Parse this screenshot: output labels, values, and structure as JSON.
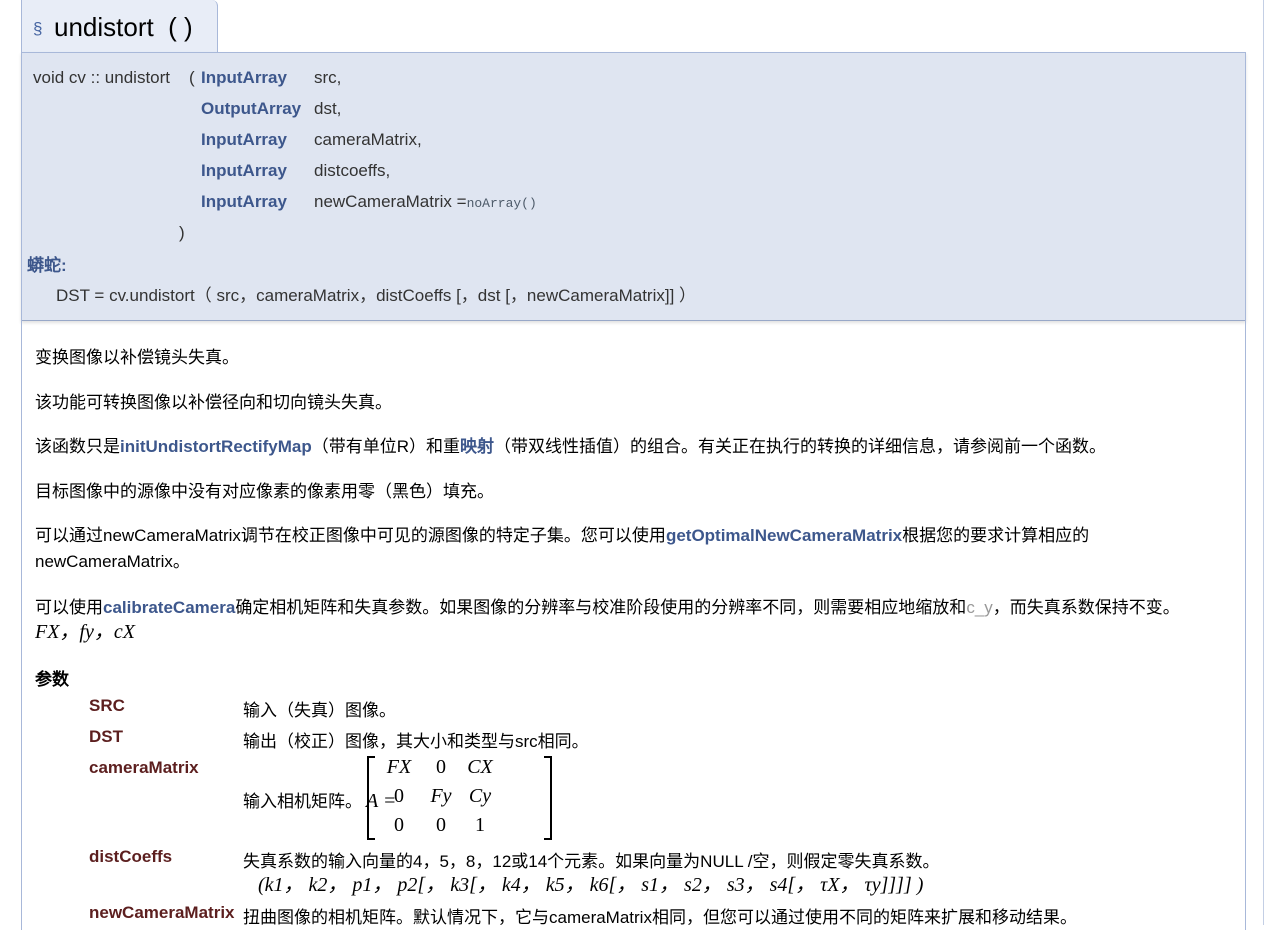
{
  "heading": {
    "section_mark": "§",
    "title": "undistort  ( )"
  },
  "signature": {
    "prefix": "void cv :: undistort",
    "open_paren": "(",
    "params": [
      {
        "type": "InputArray",
        "name": "src,"
      },
      {
        "type": "OutputArray",
        "name": "dst,"
      },
      {
        "type": "InputArray",
        "name": "cameraMatrix,"
      },
      {
        "type": "InputArray",
        "name": "distcoeffs,"
      },
      {
        "type": "InputArray",
        "name": "newCameraMatrix =",
        "default": "noArray()"
      }
    ],
    "close_paren": ")"
  },
  "python": {
    "label": "蟒蛇:",
    "code": "DST = cv.undistort（ src，cameraMatrix，distCoeffs [，dst [，newCameraMatrix]] ）"
  },
  "description": {
    "p1": "变换图像以补偿镜头失真。",
    "p2": "该功能可转换图像以补偿径向和切向镜头失真。",
    "p3": {
      "a": "该函数只是",
      "link1": "initUndistortRectifyMap",
      "b": "（带有单位R）和重",
      "link2": "映射",
      "c": "（带双线性插值）的组合。有关正在执行的转换的详细信息，请参阅前一个函数。"
    },
    "p4": "目标图像中的源像中没有对应像素的像素用零（黑色）填充。",
    "p5": {
      "a": "可以通过newCameraMatrix调节在校正图像中可见的源图像的特定子集。您可以使用",
      "link": "getOptimalNewCameraMatrix",
      "b": "根据您的要求计算相应的",
      "c": "newCameraMatrix。"
    },
    "p6": {
      "a": "可以使用",
      "link": "calibrateCamera",
      "b": "确定相机矩阵和失真参数。如果图像的分辨率与校准阶段使用的分辨率不同，则需要相应地缩放和",
      "grey": "c_y",
      "c": "，而失真系数保持不变。",
      "math": "F",
      "math_line": "FX，fy，cX"
    }
  },
  "parameters": {
    "heading": "参数",
    "items": [
      {
        "name": "SRC",
        "desc": "输入（失真）图像。"
      },
      {
        "name": "DST",
        "desc": "输出（校正）图像，其大小和类型与src相同。"
      },
      {
        "name": "cameraMatrix",
        "desc": "输入相机矩阵。"
      },
      {
        "name": "distCoeffs",
        "desc": "失真系数的输入向量的4，5，8，12或14个元素。如果向量为NULL /空，则假定零失真系数。"
      },
      {
        "name": "newCameraMatrix",
        "desc": "扭曲图像的相机矩阵。默认情况下，它与cameraMatrix相同，但您可以通过使用不同的矩阵来扩展和移动结果。"
      }
    ],
    "matrix_lhs": "A  =",
    "matrix": [
      [
        "FX",
        "0",
        "CX"
      ],
      [
        "0",
        "Fy",
        "Cy"
      ],
      [
        "0",
        "0",
        "1"
      ]
    ],
    "dist_vector": "(k1， k2， p1， p2[， k3[， k4， k5， k6[， s1， s2， s3， s4[， τX， τy]]]] )"
  }
}
